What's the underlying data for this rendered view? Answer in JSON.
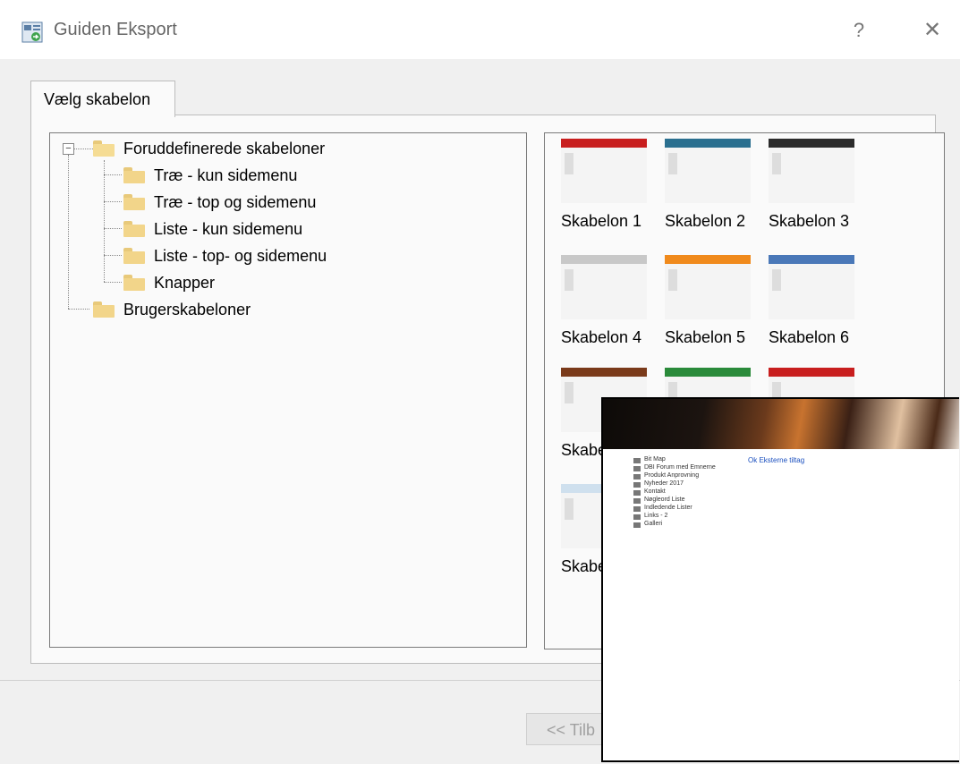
{
  "window": {
    "title": "Guiden Eksport",
    "help_label": "?",
    "close_label": "✕"
  },
  "tabs": [
    {
      "label": "Vælg skabelon"
    }
  ],
  "tree": {
    "root": {
      "label": "Foruddefinerede skabeloner",
      "expander": "−"
    },
    "children": [
      {
        "label": "Træ - kun sidemenu"
      },
      {
        "label": "Træ - top og sidemenu"
      },
      {
        "label": "Liste - kun sidemenu"
      },
      {
        "label": "Liste - top- og sidemenu"
      },
      {
        "label": "Knapper"
      }
    ],
    "user_root": {
      "label": "Brugerskabeloner"
    }
  },
  "templates": [
    {
      "label": "Skabelon 1",
      "accent": "#c81e1e"
    },
    {
      "label": "Skabelon 2",
      "accent": "#2a6f8f"
    },
    {
      "label": "Skabelon 3",
      "accent": "#2b2b2b"
    },
    {
      "label": "Skabelon 4",
      "accent": "#c8c8c8"
    },
    {
      "label": "Skabelon 5",
      "accent": "#f08a1c"
    },
    {
      "label": "Skabelon 6",
      "accent": "#4a78b8"
    },
    {
      "label": "Skabel",
      "accent": "#7a3a1a"
    },
    {
      "label": "",
      "accent": "#2a8a3a"
    },
    {
      "label": "",
      "accent": "#c81e1e"
    },
    {
      "label": "Skabe",
      "accent": "#cfe0ee"
    }
  ],
  "buttons": {
    "back": "<< Tilb"
  },
  "preview": {
    "link": "Ok Eksterne tiltag",
    "items": [
      "Bit Map",
      "DBI Forum med Emnerne",
      "Produkt Anprovning",
      "Nyheder 2017",
      "Kontakt",
      "Nøgleord Liste",
      "Indledende Lister",
      "Links - 2",
      "Galleri"
    ]
  }
}
